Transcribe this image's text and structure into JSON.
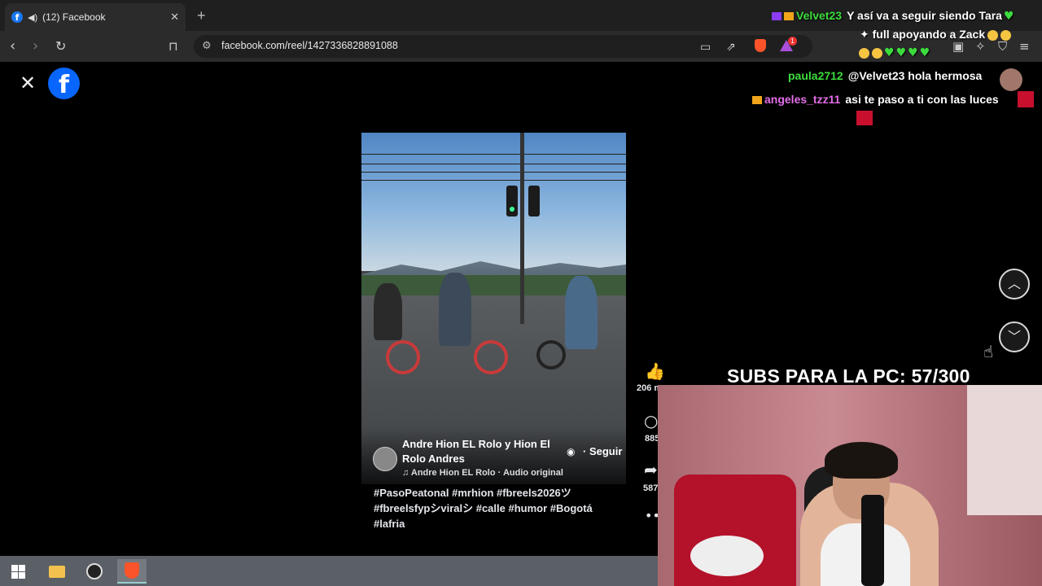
{
  "browser": {
    "tab_title": "(12) Facebook",
    "url": "facebook.com/reel/1427336828891088",
    "notification_count": "1"
  },
  "page": {
    "logo_letter": "f"
  },
  "reel": {
    "author": "Andre Hion EL Rolo y Hion El Rolo Andres",
    "follow_label": "· Seguir",
    "audio": "♫ Andre Hion EL Rolo · Audio original",
    "hashtags": "#PasoPeatonal #mrhion #fbreels2026ツ #fbreelsfypシviralシ #calle #humor #Bogotá #lafria",
    "likes": "206 m",
    "comments": "885",
    "shares": "587"
  },
  "overlay": {
    "chat": [
      {
        "user": "Velvet23",
        "user_color": "#3ddc3d",
        "message": "Y así va a seguir siendo Tara"
      },
      {
        "user": "",
        "user_color": "#ffffff",
        "message": "full apoyando a Zack"
      },
      {
        "user": "paula2712",
        "user_color": "#3ddc3d",
        "message": "@Velvet23 hola hermosa"
      },
      {
        "user": "angeles_tzz11",
        "user_color": "#e46de8",
        "message": "asi te paso a ti con las luces"
      }
    ],
    "subs_goal": "SUBS PARA LA PC: 57/300"
  },
  "colors": {
    "facebook_blue": "#0866ff",
    "brave_orange": "#fb542b",
    "chat_green": "#3ddc3d"
  }
}
